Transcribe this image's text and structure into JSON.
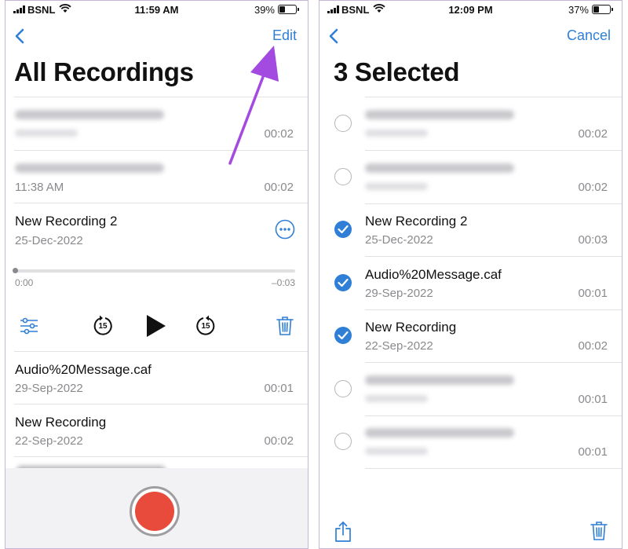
{
  "left": {
    "status": {
      "carrier": "BSNL",
      "time": "11:59 AM",
      "battery": "39%",
      "battery_level": 0.39
    },
    "nav": {
      "edit": "Edit"
    },
    "title": "All Recordings",
    "rows": [
      {
        "date": "",
        "duration": "00:02",
        "blurred": true
      },
      {
        "date": "11:38 AM",
        "duration": "00:02",
        "blurred": true
      },
      {
        "name": "New Recording 2",
        "date": "25-Dec-2022"
      },
      {
        "name": "Audio%20Message.caf",
        "date": "29-Sep-2022",
        "duration": "00:01"
      },
      {
        "name": "New Recording",
        "date": "22-Sep-2022",
        "duration": "00:02"
      }
    ],
    "player": {
      "elapsed": "0:00",
      "remaining": "–0:03",
      "progress": 0.0,
      "skip_back": "15",
      "skip_forward": "15"
    }
  },
  "right": {
    "status": {
      "carrier": "BSNL",
      "time": "12:09 PM",
      "battery": "37%",
      "battery_level": 0.37
    },
    "nav": {
      "cancel": "Cancel"
    },
    "title": "3 Selected",
    "rows": [
      {
        "duration": "00:02",
        "blurred": true,
        "checked": false
      },
      {
        "duration": "00:02",
        "blurred": true,
        "checked": false
      },
      {
        "name": "New Recording 2",
        "date": "25-Dec-2022",
        "duration": "00:03",
        "checked": true
      },
      {
        "name": "Audio%20Message.caf",
        "date": "29-Sep-2022",
        "duration": "00:01",
        "checked": true
      },
      {
        "name": "New Recording",
        "date": "22-Sep-2022",
        "duration": "00:02",
        "checked": true
      },
      {
        "duration": "00:01",
        "blurred": true,
        "checked": false
      },
      {
        "duration": "00:01",
        "blurred": true,
        "checked": false
      }
    ]
  },
  "colors": {
    "accent": "#2f7fd6",
    "record": "#e84b3c",
    "annotation_arrow": "#a34be0"
  },
  "icons": [
    "back-chevron-icon",
    "more-options-icon",
    "filter-settings-icon",
    "skip-back-15-icon",
    "play-icon",
    "skip-forward-15-icon",
    "trash-icon",
    "share-icon",
    "record-icon",
    "annotation-arrow"
  ]
}
